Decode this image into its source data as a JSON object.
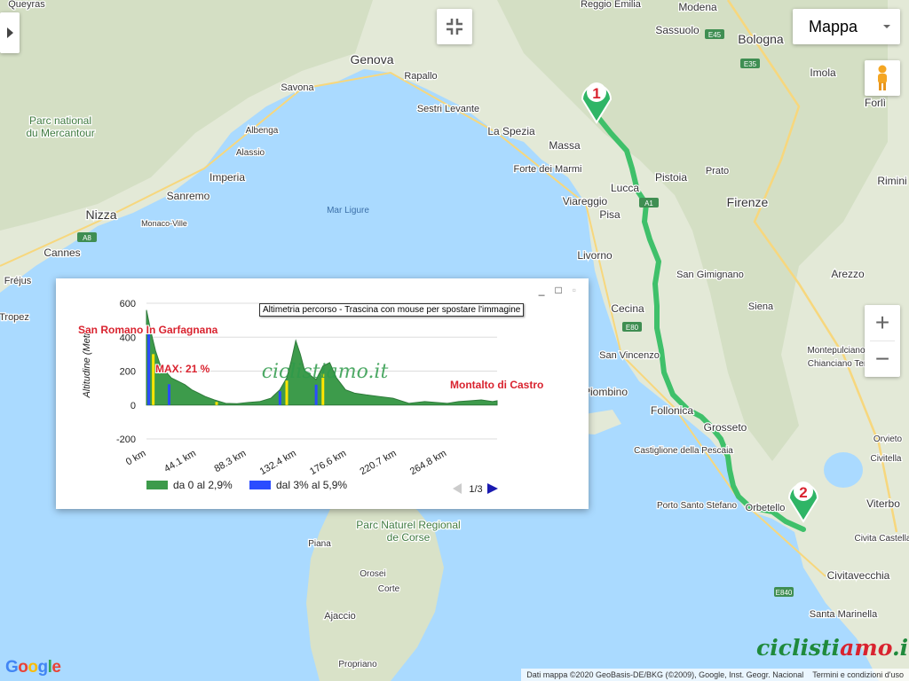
{
  "map": {
    "sea_label": "Mar Ligure",
    "cities": [
      {
        "name": "Reggio Emilia"
      },
      {
        "name": "Modena"
      },
      {
        "name": "Bologna"
      },
      {
        "name": "Imola"
      },
      {
        "name": "Forlì"
      },
      {
        "name": "Sassuolo"
      },
      {
        "name": "Genova"
      },
      {
        "name": "Rapallo"
      },
      {
        "name": "Savona"
      },
      {
        "name": "Sestri Levante"
      },
      {
        "name": "La Spezia"
      },
      {
        "name": "Massa"
      },
      {
        "name": "Forte dei Marmi"
      },
      {
        "name": "Viareggio"
      },
      {
        "name": "Lucca"
      },
      {
        "name": "Pistoia"
      },
      {
        "name": "Prato"
      },
      {
        "name": "Firenze"
      },
      {
        "name": "Pisa"
      },
      {
        "name": "Livorno"
      },
      {
        "name": "San Gimignano"
      },
      {
        "name": "Arezzo"
      },
      {
        "name": "Siena"
      },
      {
        "name": "Cecina"
      },
      {
        "name": "San Vincenzo"
      },
      {
        "name": "Piombino"
      },
      {
        "name": "Follonica"
      },
      {
        "name": "Grosseto"
      },
      {
        "name": "Castiglione della Pescaia"
      },
      {
        "name": "Porto Santo Stefano"
      },
      {
        "name": "Orbetello"
      },
      {
        "name": "Viterbo"
      },
      {
        "name": "Civitavecchia"
      },
      {
        "name": "Santa Marinella"
      },
      {
        "name": "Chianciano Terme"
      },
      {
        "name": "Orvieto"
      },
      {
        "name": "Montepulciano"
      },
      {
        "name": "Nizza"
      },
      {
        "name": "Cannes"
      },
      {
        "name": "Monaco-Ville"
      },
      {
        "name": "Sanremo"
      },
      {
        "name": "Imperia"
      },
      {
        "name": "Alassio"
      },
      {
        "name": "Albenga"
      },
      {
        "name": "Fréjus"
      },
      {
        "name": "Tropez"
      },
      {
        "name": "Queyras"
      },
      {
        "name": "Ajaccio"
      },
      {
        "name": "Propriano"
      },
      {
        "name": "Piana"
      },
      {
        "name": "Corte"
      },
      {
        "name": "Orosei"
      },
      {
        "name": "Rimini"
      },
      {
        "name": "Civita Castellana"
      },
      {
        "name": "Civitella"
      }
    ],
    "parks": [
      "Parc national du Mercantour",
      "Parc Naturel Regional de Corse"
    ],
    "markers": [
      {
        "label": "1"
      },
      {
        "label": "2"
      }
    ],
    "road_shields": [
      "A8",
      "E35",
      "E45",
      "E80",
      "E840",
      "A1"
    ]
  },
  "controls": {
    "map_type": "Mappa",
    "zoom_in": "+",
    "zoom_out": "−"
  },
  "elevation": {
    "tooltip": "Altimetria percorso - Trascina con mouse per spostare l'immagine",
    "watermark": "ciclistiamo.it",
    "pager": "1/3",
    "window_buttons": [
      "_",
      "□",
      "▫"
    ],
    "legend": [
      {
        "label": "da 0 al 2,9%",
        "color": "#3d9b4b"
      },
      {
        "label": "dal 3% al 5,9%",
        "color": "#2b4cff"
      }
    ]
  },
  "chart_data": {
    "type": "area",
    "title": "",
    "xlabel": "",
    "ylabel": "Altitudine (Metri)",
    "ylim": [
      -200,
      600
    ],
    "yticks": [
      "600",
      "400",
      "200",
      "0",
      "-200"
    ],
    "xticks": [
      "0 km",
      "44.1 km",
      "88.3 km",
      "132.4 km",
      "176.6 km",
      "220.7 km",
      "264.8 km"
    ],
    "annotations": [
      "San Romano In Garfagnana",
      "MAX: 21 %",
      "Montalto di Castro"
    ],
    "x": [
      0,
      4,
      8,
      12,
      18,
      22,
      28,
      34,
      40,
      46,
      52,
      60,
      70,
      80,
      90,
      100,
      110,
      118,
      124,
      128,
      132,
      136,
      140,
      146,
      150,
      156,
      162,
      168,
      176,
      184,
      194,
      206,
      218,
      232,
      246,
      256,
      266,
      276,
      286,
      296,
      306,
      310
    ],
    "y": [
      560,
      430,
      320,
      240,
      190,
      160,
      140,
      120,
      90,
      70,
      50,
      30,
      10,
      8,
      15,
      20,
      40,
      90,
      160,
      260,
      380,
      300,
      200,
      170,
      150,
      230,
      250,
      160,
      90,
      70,
      60,
      50,
      40,
      10,
      20,
      15,
      10,
      20,
      25,
      30,
      20,
      25
    ]
  },
  "footer": {
    "google": "Google",
    "brand": "ciclistiamo.it",
    "attribution": "Dati mappa ©2020 GeoBasis-DE/BKG (©2009), Google, Inst. Geogr. Nacional",
    "terms": "Termini e condizioni d'uso"
  },
  "colors": {
    "route": "#3fc06a",
    "marker": "#2fb566",
    "sea": "#aadaff",
    "land": "#e9ecdf"
  }
}
